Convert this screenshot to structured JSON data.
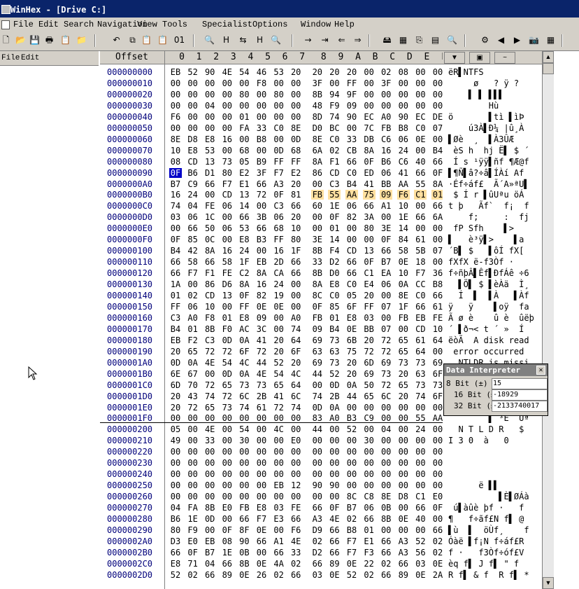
{
  "window": {
    "title": "WinHex - [Drive C:]"
  },
  "menu": [
    "File",
    "Edit",
    "Search",
    "Navigation",
    "View",
    "Tools",
    "Specialist",
    "Options",
    "Window",
    "Help"
  ],
  "left_menu": [
    "File",
    "Edit"
  ],
  "toolbar": {
    "icons": [
      "new-file-icon",
      "open-icon",
      "save-icon",
      "print-icon",
      "properties-icon",
      "open-folder-icon",
      "undo-icon",
      "copy-icon",
      "paste-icon",
      "paste-special-icon",
      "binary-icon",
      "find-icon",
      "find-hex-icon",
      "replace-icon",
      "replace-hex-icon",
      "find-next-icon",
      "goto-offset-icon",
      "goto-icon",
      "back-icon",
      "forward-icon",
      "disk-icon",
      "ram-icon",
      "clone-icon",
      "calculator-icon",
      "magnifier-icon",
      "settings-icon",
      "prev-icon",
      "next-icon",
      "camera-icon",
      "grid-icon"
    ],
    "glyphs": [
      "🗋",
      "📂",
      "💾",
      "🖶",
      "📋",
      "📁",
      "↶",
      "⧉",
      "📋",
      "📋",
      "01",
      "🔍",
      "H",
      "⇆",
      "H",
      "🔍",
      "→",
      "⇥",
      "⇐",
      "⇒",
      "🖴",
      "▦",
      "⎘",
      "▤",
      "🔍",
      "⚙",
      "◀",
      "▶",
      "📷",
      "▦"
    ]
  },
  "header": {
    "offset_label": "Offset",
    "columns": [
      "0",
      "1",
      "2",
      "3",
      "4",
      "5",
      "6",
      "7",
      "8",
      "9",
      "A",
      "B",
      "C",
      "D",
      "E",
      "F"
    ]
  },
  "rows": [
    {
      "off": "000000000",
      "hex": "EB 52 90 4E 54 46 53 20 20 20 20 00 02 08 00 00",
      "txt": "ëR▌NTFS"
    },
    {
      "off": "000000010",
      "hex": "00 00 00 00 00 F8 00 00 3F 00 FF 00 3F 00 00 00",
      "txt": "     ø   ? ÿ ?"
    },
    {
      "off": "000000020",
      "hex": "00 00 00 00 80 00 80 00 8B 94 9F 00 00 00 00 00",
      "txt": "    ▌ ▌ ▌▌▌"
    },
    {
      "off": "000000030",
      "hex": "00 00 04 00 00 00 00 00 48 F9 09 00 00 00 00 00",
      "txt": "        Hù"
    },
    {
      "off": "000000040",
      "hex": "F6 00 00 00 01 00 00 00 8D 74 90 EC A0 90 EC DE",
      "txt": "ö       ▌tì ▌ìÞ"
    },
    {
      "off": "000000050",
      "hex": "00 00 00 00 FA 33 C0 8E D0 BC 00 7C FB B8 C0 07",
      "txt": "    ú3À▌Ð¼ |û¸À"
    },
    {
      "off": "000000060",
      "hex": "8E D8 E8 16 00 B8 00 0D 8E C0 33 DB C6 06 0E 00",
      "txt": "▌Øè  ¸  ▌À3ÛÆ"
    },
    {
      "off": "000000070",
      "hex": "10 E8 53 00 68 00 0D 68 6A 02 CB 8A 16 24 00 B4",
      "txt": " èS h  hj Ë▌ $ ´"
    },
    {
      "off": "000000080",
      "hex": "08 CD 13 73 05 B9 FF FF 8A F1 66 0F B6 C6 40 66",
      "txt": " Í s ¹ÿÿ▌ñf ¶Æ@f"
    },
    {
      "off": "000000090",
      "hex": "0F B6 D1 80 E2 3F F7 E2 86 CD C0 ED 06 41 66 0F",
      "txt": "▌¶Ñ▌â?÷â▌ÍÀí Af"
    },
    {
      "off": "0000000A0",
      "hex": "B7 C9 66 F7 E1 66 A3 20 00 C3 B4 41 BB AA 55 8A",
      "txt": "·Éf÷áf£  Ã´A»ªU▌"
    },
    {
      "off": "0000000B0",
      "hex": "16 24 00 CD 13 72 0F 81 FB 55 AA 75 09 F6 C1 01",
      "txt": " $ Í r ▌ûUªu öÁ"
    },
    {
      "off": "0000000C0",
      "hex": "74 04 FE 06 14 00 C3 66 60 1E 06 66 A1 10 00 66",
      "txt": "t þ   Ãf`  f¡  f"
    },
    {
      "off": "0000000D0",
      "hex": "03 06 1C 00 66 3B 06 20 00 0F 82 3A 00 1E 66 6A",
      "txt": "    f;     :  fj"
    },
    {
      "off": "0000000E0",
      "hex": "00 66 50 06 53 66 68 10 00 01 00 80 3E 14 00 00",
      "txt": " fP Sfh    ▌>"
    },
    {
      "off": "0000000F0",
      "hex": "0F 85 0C 00 E8 B3 FF 80 3E 14 00 00 0F 84 61 00",
      "txt": "▌   è³ÿ▌>    ▌a"
    },
    {
      "off": "000000100",
      "hex": "B4 42 8A 16 24 00 16 1F 8B F4 CD 13 66 58 5B 07",
      "txt": "´B▌ $   ▌ôÍ fX["
    },
    {
      "off": "000000110",
      "hex": "66 58 66 58 1F EB 2D 66 33 D2 66 0F B7 0E 18 00",
      "txt": "fXfX ë-f3Òf ·"
    },
    {
      "off": "000000120",
      "hex": "66 F7 F1 FE C2 8A CA 66 8B D0 66 C1 EA 10 F7 36",
      "txt": "f÷ñþÂ▌Êf▌ÐfÁê ÷6"
    },
    {
      "off": "000000130",
      "hex": "1A 00 86 D6 8A 16 24 00 8A E8 C0 E4 06 0A CC B8",
      "txt": "  ▌Ö▌ $ ▌èÀä  Ì¸"
    },
    {
      "off": "000000140",
      "hex": "01 02 CD 13 0F 82 19 00 8C C0 05 20 00 8E C0 66",
      "txt": "  Í  ▌  ▌À   ▌Àf"
    },
    {
      "off": "000000150",
      "hex": "FF 06 10 00 FF 0E 0E 00 0F 85 6F FF 07 1F 66 61",
      "txt": "ÿ   ÿ    ▌oÿ  fa"
    },
    {
      "off": "000000160",
      "hex": "C3 A0 F8 01 E8 09 00 A0 FB 01 E8 03 00 FB EB FE",
      "txt": "Ã ø è    û è  ûëþ"
    },
    {
      "off": "000000170",
      "hex": "B4 01 8B F0 AC 3C 00 74 09 B4 0E BB 07 00 CD 10",
      "txt": "´ ▌ð¬< t ´ »  Í"
    },
    {
      "off": "000000180",
      "hex": "EB F2 C3 0D 0A 41 20 64 69 73 6B 20 72 65 61 64",
      "txt": "ëòÃ  A disk read"
    },
    {
      "off": "000000190",
      "hex": "20 65 72 72 6F 72 20 6F 63 63 75 72 72 65 64 00",
      "txt": " error occurred"
    },
    {
      "off": "0000001A0",
      "hex": "0D 0A 4E 54 4C 44 52 20 69 73 20 6D 69 73 73 69",
      "txt": "  NTLDR is missi"
    },
    {
      "off": "0000001B0",
      "hex": "6E 67 00 0D 0A 4E 54 4C 44 52 20 69 73 20 63 6F",
      "txt": ""
    },
    {
      "off": "0000001C0",
      "hex": "6D 70 72 65 73 73 65 64 00 0D 0A 50 72 65 73 73",
      "txt": ""
    },
    {
      "off": "0000001D0",
      "hex": "20 43 74 72 6C 2B 41 6C 74 2B 44 65 6C 20 74 6F",
      "txt": ""
    },
    {
      "off": "0000001E0",
      "hex": "20 72 65 73 74 61 72 74 0D 0A 00 00 00 00 00 00",
      "txt": ""
    },
    {
      "off": "0000001F0",
      "hex": "00 00 00 00 00 00 00 00 83 A0 B3 C9 00 00 55 AA",
      "txt": "        ▌ ³É  Uª"
    },
    {
      "off": "000000200",
      "hex": "05 00 4E 00 54 00 4C 00 44 00 52 00 04 00 24 00",
      "txt": "  N T L D R   $"
    },
    {
      "off": "000000210",
      "hex": "49 00 33 00 30 00 00 E0 00 00 00 30 00 00 00 00",
      "txt": "I 3 0  à   0"
    },
    {
      "off": "000000220",
      "hex": "00 00 00 00 00 00 00 00 00 00 00 00 00 00 00 00",
      "txt": ""
    },
    {
      "off": "000000230",
      "hex": "00 00 00 00 00 00 00 00 00 00 00 00 00 00 00 00",
      "txt": ""
    },
    {
      "off": "000000240",
      "hex": "00 00 00 00 00 00 00 00 00 00 00 00 00 00 00 00",
      "txt": ""
    },
    {
      "off": "000000250",
      "hex": "00 00 00 00 00 00 EB 12 90 90 00 00 00 00 00 00",
      "txt": "      ë ▌▌"
    },
    {
      "off": "000000260",
      "hex": "00 00 00 00 00 00 00 00 00 00 8C C8 8E D8 C1 E0",
      "txt": "          ▌È▌ØÁà"
    },
    {
      "off": "000000270",
      "hex": "04 FA 8B E0 FB E8 03 FE 66 0F B7 06 0B 00 66 0F",
      "txt": " ú▌àûè þf ·   f"
    },
    {
      "off": "000000280",
      "hex": "B6 1E 0D 00 66 F7 E3 66 A3 4E 02 66 8B 0E 40 00",
      "txt": "¶   f÷ãf£N f▌ @"
    },
    {
      "off": "000000290",
      "hex": "80 F9 00 0F 8F 0E 00 F6 D9 66 B8 01 00 00 00 66",
      "txt": "▌ù  ▌  öÙf¸    f"
    },
    {
      "off": "0000002A0",
      "hex": "D3 E0 EB 08 90 66 A1 4E 02 66 F7 E1 66 A3 52 02",
      "txt": "Óàë ▌f¡N f÷áf£R"
    },
    {
      "off": "0000002B0",
      "hex": "66 0F B7 1E 0B 00 66 33 D2 66 F7 F3 66 A3 56 02",
      "txt": "f ·   f3Òf÷óf£V"
    },
    {
      "off": "0000002C0",
      "hex": "E8 71 04 66 8B 0E 4A 02 66 89 0E 22 02 66 03 0E",
      "txt": "èq f▌ J f▌ \" f"
    },
    {
      "off": "0000002D0",
      "hex": "52 02 66 89 0E 26 02 66 03 0E 52 02 66 89 0E 2A",
      "txt": "R f▌ & f  R f▌ *"
    }
  ],
  "highlight": {
    "row": 11,
    "from": 8,
    "to": 15
  },
  "cursor": {
    "row": 9,
    "col": 0
  },
  "data_interpreter": {
    "title": "Data Interpreter",
    "rows": [
      {
        "label": "8 Bit (±)",
        "value": "15"
      },
      {
        "label": "16 Bit (±)",
        "value": "-18929"
      },
      {
        "label": "32 Bit (±)",
        "value": "-2133740017"
      }
    ]
  }
}
